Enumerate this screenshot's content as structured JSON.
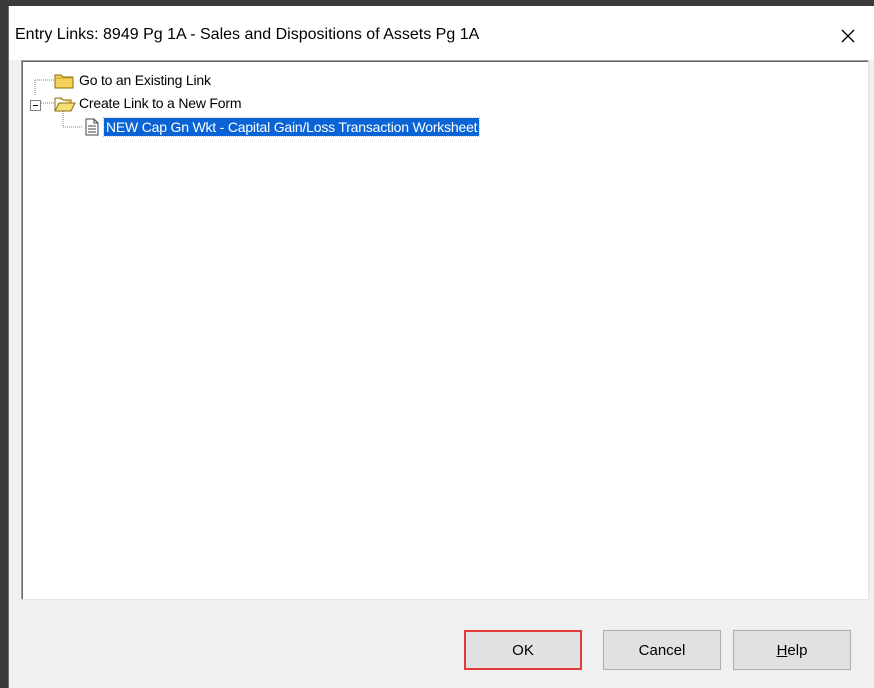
{
  "window": {
    "title": "Entry Links: 8949 Pg 1A - Sales and Dispositions of Assets Pg 1A",
    "close_glyph": "✕"
  },
  "tree": {
    "nodes": [
      {
        "label": "Go to an Existing Link",
        "icon": "closed-folder-icon"
      },
      {
        "label": "Create Link to a New Form",
        "icon": "open-folder-icon",
        "expander": "−"
      },
      {
        "label": "NEW Cap Gn Wkt - Capital Gain/Loss Transaction Worksheet",
        "icon": "document-icon",
        "selected": true
      }
    ]
  },
  "buttons": {
    "ok": "OK",
    "cancel": "Cancel",
    "help_mnemonic": "H",
    "help_rest": "elp"
  },
  "colors": {
    "selection": "#0a64d6",
    "focus_highlight": "#e03a3a",
    "folder": "#f5d35a"
  }
}
